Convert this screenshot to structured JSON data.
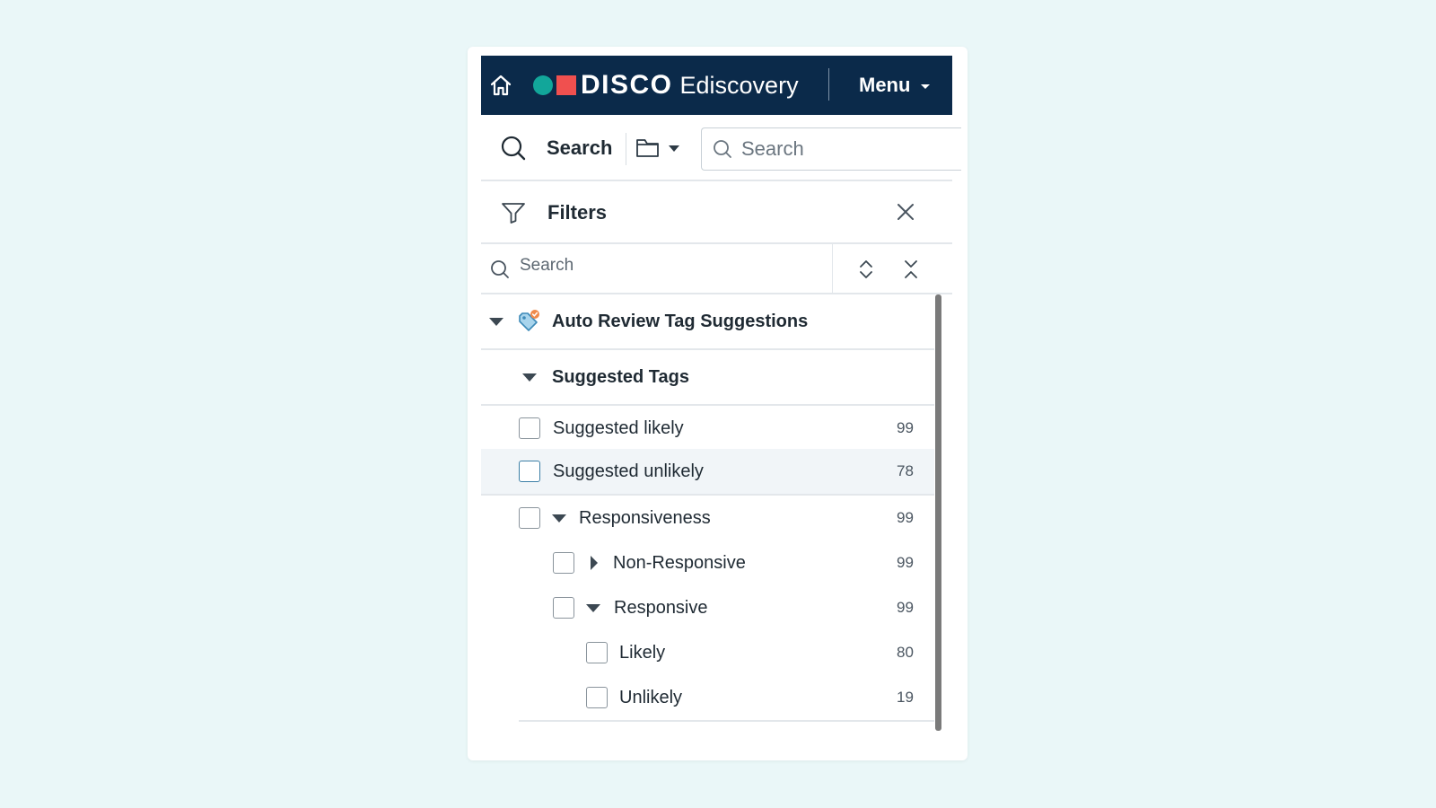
{
  "header": {
    "brand": "DISCO",
    "product": "Ediscovery",
    "menu_label": "Menu",
    "colors": {
      "background": "#0b2a4a",
      "dot": "#12a69a",
      "square": "#f0504f"
    }
  },
  "toolbar": {
    "search_label": "Search",
    "search_placeholder": "Search"
  },
  "filters": {
    "title": "Filters",
    "search_placeholder": "Search"
  },
  "tree": {
    "group": {
      "label": "Auto Review Tag Suggestions",
      "icon": "tag-suggestion-icon"
    },
    "subgroup": {
      "label": "Suggested Tags"
    },
    "items": [
      {
        "label": "Suggested likely",
        "count": "99"
      },
      {
        "label": "Suggested unlikely",
        "count": "78",
        "highlighted": true
      },
      {
        "label": "Responsiveness",
        "count": "99",
        "expanded": true
      },
      {
        "label": "Non-Responsive",
        "count": "99",
        "expanded": false
      },
      {
        "label": "Responsive",
        "count": "99",
        "expanded": true
      },
      {
        "label": "Likely",
        "count": "80"
      },
      {
        "label": "Unlikely",
        "count": "19"
      }
    ]
  }
}
